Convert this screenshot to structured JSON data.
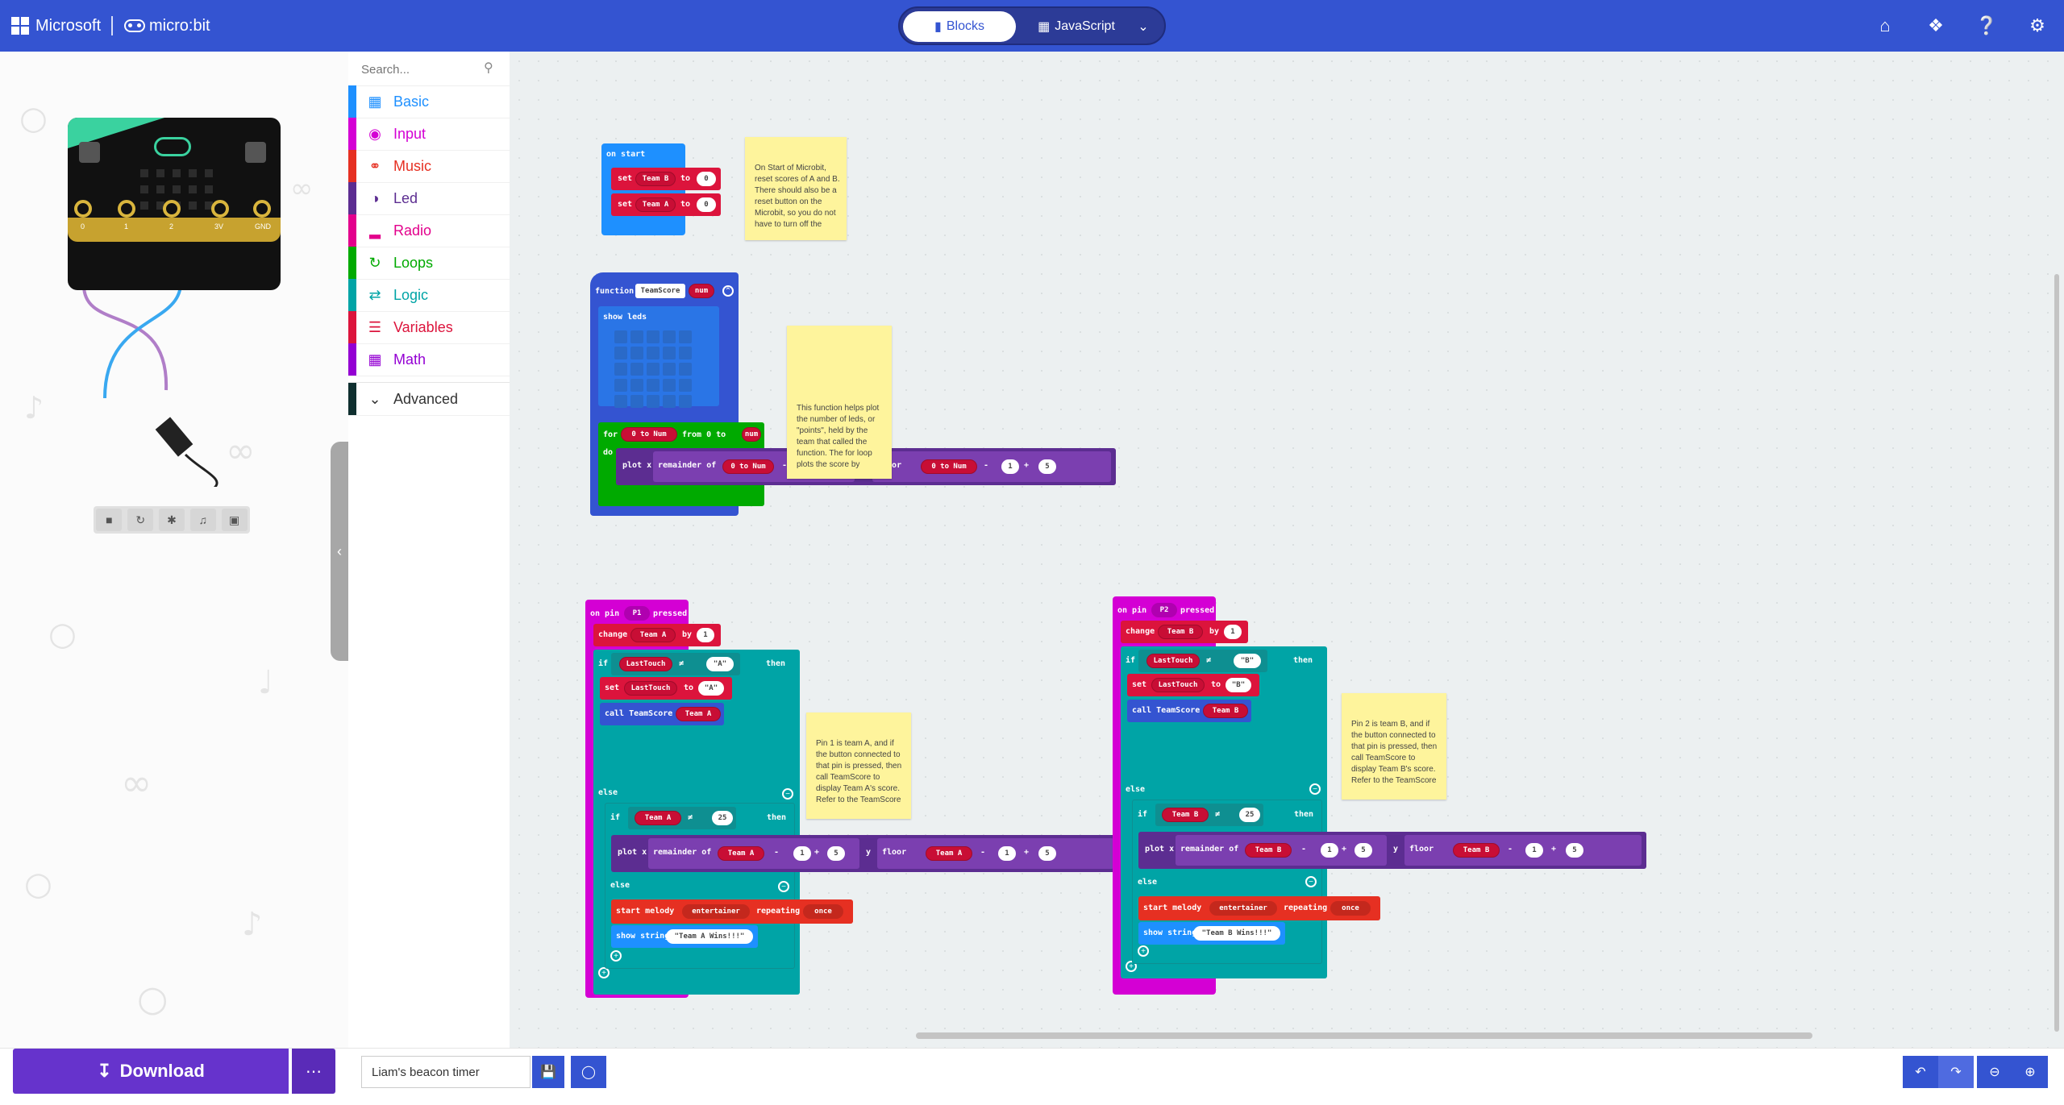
{
  "header": {
    "microsoft_label": "Microsoft",
    "microbit_label": "micro:bit",
    "blocks_tab": "Blocks",
    "javascript_tab": "JavaScript"
  },
  "simulator": {
    "pins": [
      "0",
      "1",
      "2",
      "3V",
      "GND"
    ]
  },
  "toolbox": {
    "search_placeholder": "Search...",
    "categories": [
      {
        "label": "Basic",
        "color": "#1e90ff",
        "icon": "grid-icon"
      },
      {
        "label": "Input",
        "color": "#d400d4",
        "icon": "target-icon"
      },
      {
        "label": "Music",
        "color": "#e63022",
        "icon": "headphones-icon"
      },
      {
        "label": "Led",
        "color": "#5c2d91",
        "icon": "toggle-icon"
      },
      {
        "label": "Radio",
        "color": "#e3008c",
        "icon": "signal-icon"
      },
      {
        "label": "Loops",
        "color": "#00aa00",
        "icon": "refresh-icon"
      },
      {
        "label": "Logic",
        "color": "#00a4a6",
        "icon": "shuffle-icon"
      },
      {
        "label": "Variables",
        "color": "#dc143c",
        "icon": "lines-icon"
      },
      {
        "label": "Math",
        "color": "#9400d3",
        "icon": "calculator-icon"
      }
    ],
    "advanced_label": "Advanced"
  },
  "workspace": {
    "on_start": {
      "title": "on start",
      "set_label": "set",
      "to_label": "to",
      "var_b": "Team B",
      "var_a": "Team A",
      "zero": "0"
    },
    "note1": "On Start of Microbit, reset scores of A and B. There should also be a reset button on the Microbit, so you do not have to turn off the",
    "function": {
      "keyword": "function",
      "name": "TeamScore",
      "param": "num",
      "show_leds": "show leds",
      "for_label": "for",
      "loop_var": "0 to Num",
      "from_label": "from 0 to",
      "do_label": "do",
      "plot_x": "plot x",
      "remainder_of": "remainder of",
      "minus": "-",
      "plus": "+",
      "y_label": "y",
      "floor_label": "floor",
      "one": "1",
      "five": "5"
    },
    "note2": "This function helps plot the number of leds, or \"points\", held by the team that called the function. The for loop plots the score by",
    "pin1": {
      "header": "on pin",
      "pin": "P1",
      "pressed": "pressed",
      "change": "change",
      "team": "Team A",
      "by": "by",
      "if_label": "if",
      "last_touch": "LastTouch",
      "neq": "≠",
      "letter": "\"A\"",
      "then_label": "then",
      "set_label": "set",
      "to_label": "to",
      "call": "call TeamScore",
      "else_label": "else",
      "score_25": "25",
      "start_melody": "start melody",
      "melody": "entertainer",
      "repeating": "repeating",
      "once": "once",
      "show_string": "show string",
      "win_text": "\"Team A Wins!!!\""
    },
    "note3": "Pin 1 is team A, and if the button connected to that pin is pressed, then call TeamScore to display Team A's score. Refer to the TeamScore",
    "pin2": {
      "header": "on pin",
      "pin": "P2",
      "pressed": "pressed",
      "change": "change",
      "team": "Team B",
      "by": "by",
      "if_label": "if",
      "last_touch": "LastTouch",
      "neq": "≠",
      "letter": "\"B\"",
      "then_label": "then",
      "set_label": "set",
      "to_label": "to",
      "call": "call TeamScore",
      "else_label": "else",
      "score_25": "25",
      "start_melody": "start melody",
      "melody": "entertainer",
      "repeating": "repeating",
      "once": "once",
      "show_string": "show string",
      "win_text": "\"Team B Wins!!!\""
    },
    "note4": "Pin 2 is team B, and if the button connected to that pin is pressed, then call TeamScore to display Team B's score. Refer to the TeamScore"
  },
  "footer": {
    "download_label": "Download",
    "project_name": "Liam's beacon timer"
  }
}
